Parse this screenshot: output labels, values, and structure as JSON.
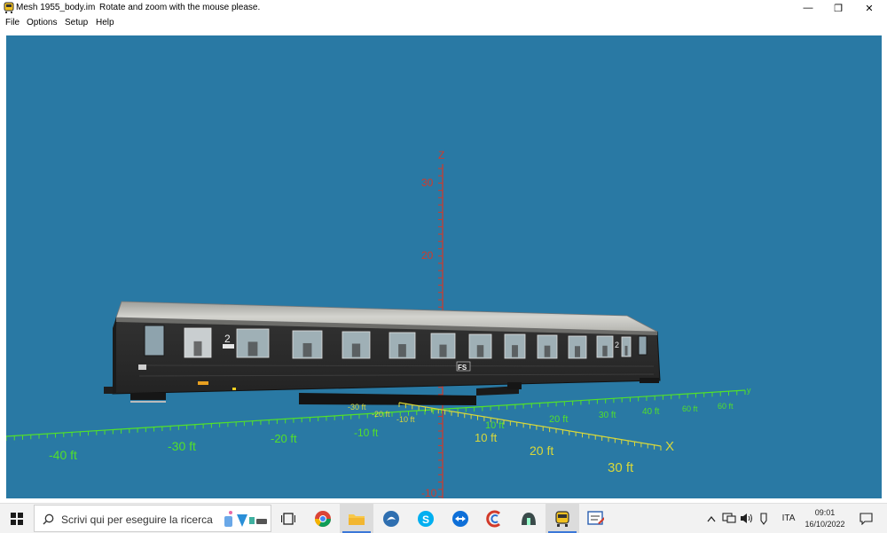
{
  "window": {
    "title": "Mesh 1955_body.im",
    "hint": "Rotate and zoom with the mouse please.",
    "minimize_glyph": "—",
    "restore_glyph": "❐",
    "close_glyph": "✕"
  },
  "menu": [
    "File",
    "Options",
    "Setup",
    "Help"
  ],
  "scene": {
    "z_axis": {
      "label": "Z",
      "ticks": [
        "30",
        "20",
        "-10"
      ]
    },
    "x_axis": {
      "label": "X",
      "ticks": [
        "10 ft",
        "20 ft",
        "30 ft"
      ]
    },
    "y_axis": {
      "label": "y",
      "ticks": [
        "-40 ft",
        "-30 ft",
        "-20 ft",
        "-10 ft",
        "10 ft",
        "20 ft",
        "30 ft",
        "40 ft",
        "60 ft",
        "60 ft"
      ]
    },
    "near_origin_ticks": [
      "-30 ft",
      "-20 ft",
      "-10 ft"
    ],
    "coach": {
      "class_label": "2",
      "class_label_rear": "2",
      "logo": "FS"
    },
    "colors": {
      "background": "#2979a4",
      "y_axis": "#52e02a",
      "x_axis": "#d8d83a",
      "z_axis": "#d23a2a",
      "coach_body": "#2c2c2c",
      "roof": "#b9b9b5"
    }
  },
  "taskbar": {
    "search_placeholder": "Scrivi qui per eseguire la ricerca",
    "icons": [
      "windows-start-icon",
      "task-view-icon",
      "chrome-icon",
      "file-explorer-icon",
      "app-bird-icon",
      "skype-icon",
      "teamviewer-icon",
      "app-c-icon",
      "app-dome-icon",
      "train-app-icon",
      "editor-icon"
    ],
    "language": "ITA",
    "time": "09:01",
    "date": "16/10/2022"
  }
}
